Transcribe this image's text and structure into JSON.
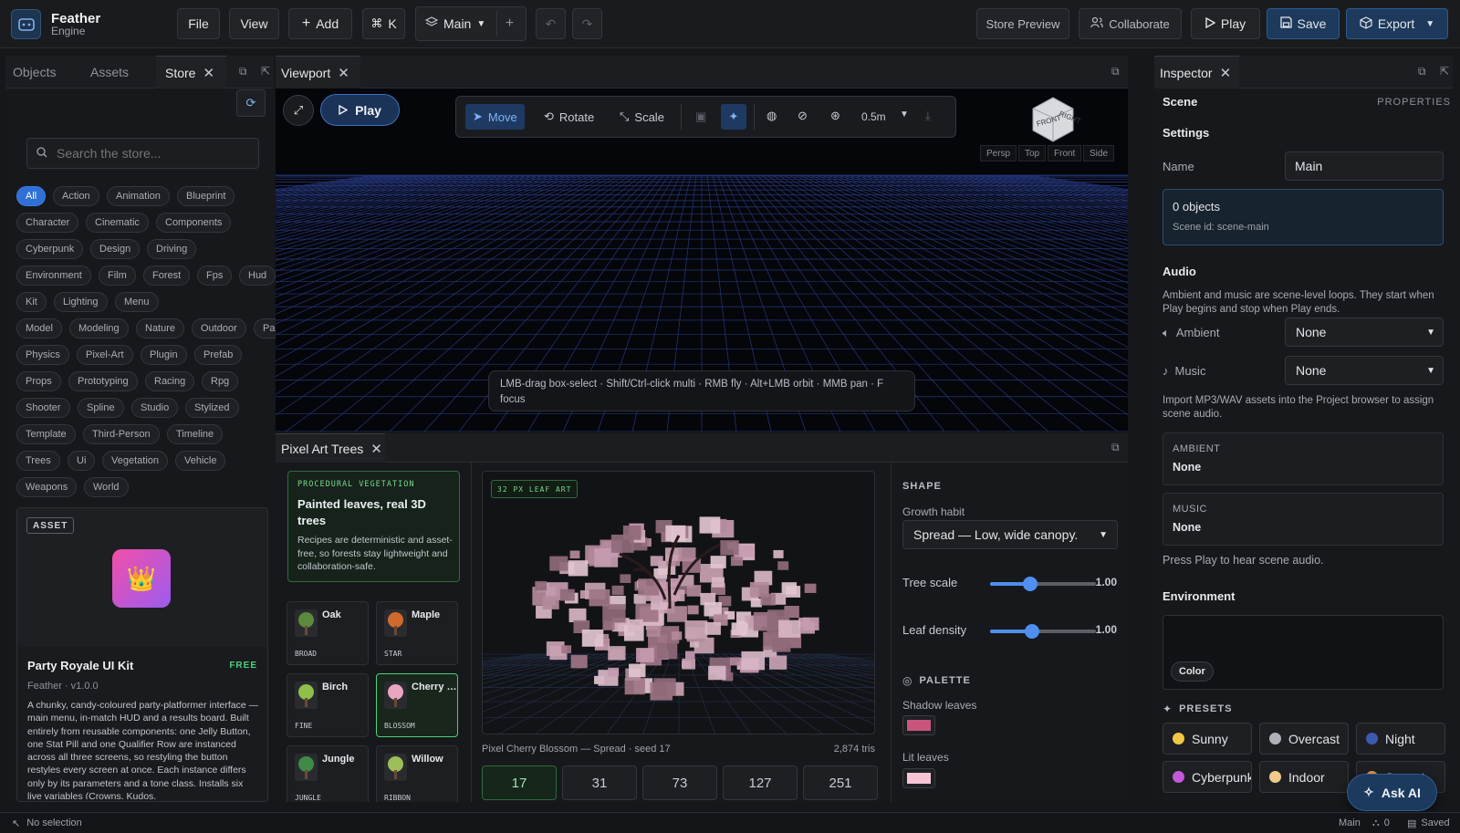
{
  "app": {
    "name": "Feather",
    "subtitle": "Engine"
  },
  "toolbar": {
    "file": "File",
    "view": "View",
    "add": "Add",
    "shortcut": "K",
    "scene": "Main",
    "store_preview": "Store Preview",
    "collaborate": "Collaborate",
    "play": "Play",
    "save": "Save",
    "export": "Export"
  },
  "left": {
    "tabs": [
      "Objects",
      "Assets",
      "Store"
    ],
    "search_placeholder": "Search the store...",
    "chips": [
      "All",
      "Action",
      "Animation",
      "Blueprint",
      "Character",
      "Cinematic",
      "Components",
      "Cyberpunk",
      "Design",
      "Driving",
      "Environment",
      "Film",
      "Forest",
      "Fps",
      "Hud",
      "Kit",
      "Lighting",
      "Menu",
      "Model",
      "Modeling",
      "Nature",
      "Outdoor",
      "Party",
      "Physics",
      "Pixel-Art",
      "Plugin",
      "Prefab",
      "Props",
      "Prototyping",
      "Racing",
      "Rpg",
      "Shooter",
      "Spline",
      "Studio",
      "Stylized",
      "Template",
      "Third-Person",
      "Timeline",
      "Trees",
      "Ui",
      "Vegetation",
      "Vehicle",
      "Weapons",
      "World"
    ],
    "card": {
      "badge": "ASSET",
      "emoji": "👑",
      "title": "Party Royale UI Kit",
      "price": "FREE",
      "meta": "Feather · v1.0.0",
      "desc": "A chunky, candy-coloured party-platformer interface — main menu, in-match HUD and a results board. Built entirely from reusable components: one Jelly Button, one Stat Pill and one Qualifier Row are instanced across all three screens, so restyling the button restyles every screen at once. Each instance differs only by its parameters and a tone class. Installs six live variables (Crowns, Kudos,"
    }
  },
  "viewport": {
    "tab": "Viewport",
    "play": "Play",
    "tools": {
      "move": "Move",
      "rotate": "Rotate",
      "scale": "Scale",
      "snap": "0.5m"
    },
    "cube": {
      "front": "FRONT",
      "right": "RIGHT"
    },
    "views": [
      "Persp",
      "Top",
      "Front",
      "Side"
    ],
    "hint": "LMB-drag box-select · Shift/Ctrl-click multi · RMB fly · Alt+LMB orbit · MMB pan · F focus"
  },
  "trees": {
    "tab": "Pixel Art Trees",
    "promo": {
      "tag": "PROCEDURAL VEGETATION",
      "title": "Painted leaves, real 3D trees",
      "body": "Recipes are deterministic and asset-free, so forests stay lightweight and collaboration-safe."
    },
    "items": [
      {
        "name": "Oak",
        "tag": "BROAD"
      },
      {
        "name": "Maple",
        "tag": "STAR"
      },
      {
        "name": "Birch",
        "tag": "FINE"
      },
      {
        "name": "Cherry Blossom",
        "tag": "BLOSSOM"
      },
      {
        "name": "Jungle",
        "tag": "JUNGLE"
      },
      {
        "name": "Willow",
        "tag": "RIBBON"
      }
    ],
    "preview_badge": "32 PX LEAF ART",
    "caption": "Pixel Cherry Blossom — Spread · seed 17",
    "tris": "2,874 tris",
    "seeds": [
      "17",
      "31",
      "73",
      "127",
      "251"
    ],
    "shape": {
      "heading": "SHAPE",
      "growth_label": "Growth habit",
      "growth_value": "Spread — Low, wide canopy.",
      "scale_label": "Tree scale",
      "scale_value": "1.00",
      "scale_level": 0.38,
      "density_label": "Leaf density",
      "density_value": "1.00",
      "density_level": 0.4
    },
    "palette": {
      "heading": "PALETTE",
      "shadow_label": "Shadow leaves",
      "shadow_color": "#c9557d",
      "lit_label": "Lit leaves",
      "lit_color": "#f7c4d6"
    }
  },
  "inspector": {
    "tab": "Inspector",
    "title": "Scene",
    "properties": "PROPERTIES",
    "settings": "Settings",
    "name_label": "Name",
    "name_value": "Main",
    "objects": "0 objects",
    "scene_id": "Scene id: scene-main",
    "audio": "Audio",
    "audio_desc": "Ambient and music are scene-level loops. They start when Play begins and stop when Play ends.",
    "ambient_label": "Ambient",
    "ambient_value": "None",
    "music_label": "Music",
    "music_value": "None",
    "import_note": "Import MP3/WAV assets into the Project browser to assign scene audio.",
    "ambient_card_label": "AMBIENT",
    "ambient_card_value": "None",
    "music_card_label": "MUSIC",
    "music_card_value": "None",
    "press_play": "Press Play to hear scene audio.",
    "environment": "Environment",
    "color_btn": "Color",
    "presets_heading": "PRESETS",
    "presets": [
      {
        "name": "Sunny",
        "color": "#f2c744"
      },
      {
        "name": "Overcast",
        "color": "#aeb2b8"
      },
      {
        "name": "Night",
        "color": "#3c5bb0"
      },
      {
        "name": "Cyberpunk",
        "color": "#c558d8"
      },
      {
        "name": "Indoor",
        "color": "#f1c98a"
      },
      {
        "name": "Sunset",
        "color": "#f29a3c"
      }
    ],
    "ask_ai": "Ask AI"
  },
  "status": {
    "selection": "No selection",
    "scene": "Main",
    "users": "0",
    "saved": "Saved"
  }
}
